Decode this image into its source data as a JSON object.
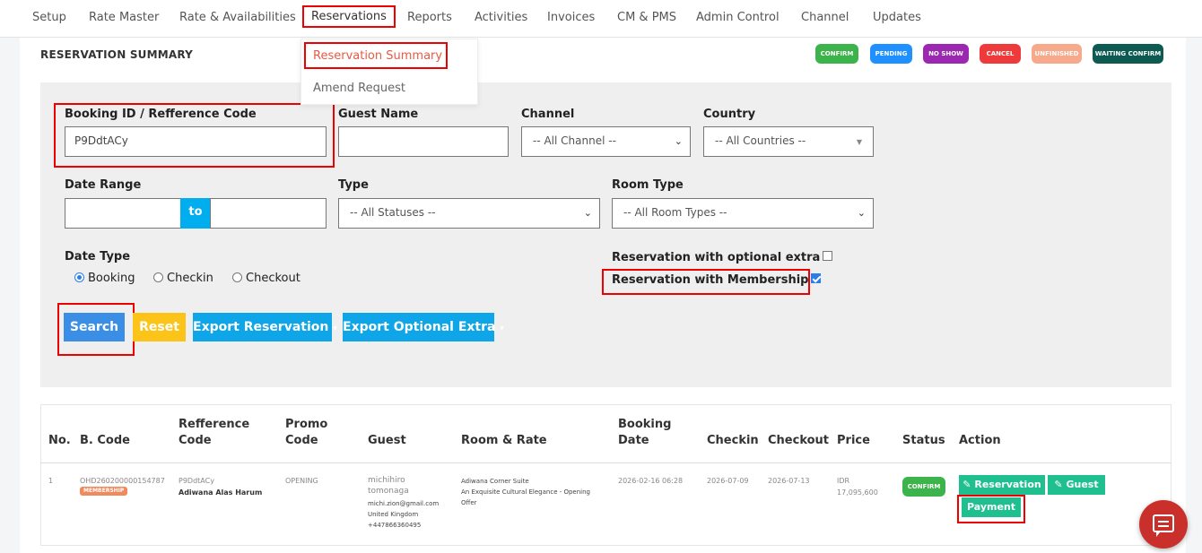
{
  "nav": {
    "items": [
      "Setup",
      "Rate Master",
      "Rate & Availabilities",
      "Reservations",
      "Reports",
      "Activities",
      "Invoices",
      "CM & PMS",
      "Admin Control",
      "Channel",
      "Updates"
    ]
  },
  "dropdown": {
    "items": [
      "Reservation Summary",
      "Amend Request"
    ]
  },
  "page_title": "RESERVATION SUMMARY",
  "legend": [
    {
      "label": "CONFIRM",
      "color": "#3cb44b"
    },
    {
      "label": "PENDING",
      "color": "#1e90ff"
    },
    {
      "label": "NO SHOW",
      "color": "#9c27b0"
    },
    {
      "label": "CANCEL",
      "color": "#ee3a3a"
    },
    {
      "label": "UNFINISHED",
      "color": "#f7a98b"
    },
    {
      "label": "WAITING CONFIRM",
      "color": "#0d5a52"
    }
  ],
  "filters": {
    "booking_id_label": "Booking ID / Refference Code",
    "booking_id_value": "P9DdtACy",
    "guest_name_label": "Guest Name",
    "guest_name_value": "",
    "channel_label": "Channel",
    "channel_value": "-- All Channel --",
    "country_label": "Country",
    "country_value": "-- All Countries --",
    "date_range_label": "Date Range",
    "date_range_to": "to",
    "type_label": "Type",
    "type_value": "-- All Statuses --",
    "room_type_label": "Room Type",
    "room_type_value": "-- All Room Types --",
    "date_type_label": "Date Type",
    "date_type_options": [
      "Booking",
      "Checkin",
      "Checkout"
    ],
    "date_type_selected": "Booking",
    "optional_extra_label": "Reservation with optional extra",
    "optional_extra_checked": false,
    "membership_label": "Reservation with Membership",
    "membership_checked": true
  },
  "buttons": {
    "search": "Search",
    "reset": "Reset",
    "export_reservation": "Export Reservation",
    "export_optional_extra": "Export Optional Extra"
  },
  "table": {
    "headers": {
      "no": "No.",
      "bcode": "B. Code",
      "ref1": "Refference",
      "ref2": "Code",
      "promo1": "Promo",
      "promo2": "Code",
      "guest": "Guest",
      "room": "Room & Rate",
      "bdate1": "Booking",
      "bdate2": "Date",
      "checkin": "Checkin",
      "checkout": "Checkout",
      "price": "Price",
      "status": "Status",
      "action": "Action"
    },
    "rows": [
      {
        "no": "1",
        "bcode": "OHD260200000154787",
        "badge": "MEMBERSHIP",
        "ref_code": "P9DdtACy",
        "hotel": "Adiwana Alas Harum",
        "promo": "OPENING",
        "guest_name1": "michihiro",
        "guest_name2": "tomonaga",
        "guest_email": "michi.zion@gmail.com",
        "guest_country": "United Kingdom",
        "guest_phone": "+447866360495",
        "room": "Adiwana Corner Suite",
        "rate1": "An Exquisite Cultural Elegance - Opening",
        "rate2": "Offer",
        "booking_date": "2026-02-16 06:28",
        "checkin": "2026-07-09",
        "checkout": "2026-07-13",
        "price1": "IDR",
        "price2": "17,095,600",
        "status": "CONFIRM",
        "actions": {
          "reservation": "Reservation",
          "guest": "Guest",
          "payment": "Payment"
        }
      }
    ]
  }
}
